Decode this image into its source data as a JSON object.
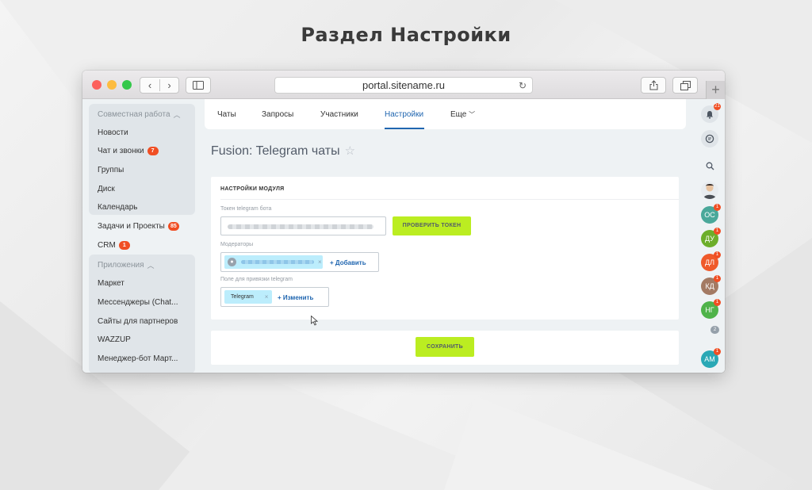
{
  "headline": "Раздел  Настройки",
  "browser": {
    "url": "portal.sitename.ru",
    "reload_icon": "reload-icon",
    "share_icon": "share-icon",
    "tabs_icon": "tabs-icon",
    "new_tab_symbol": "+"
  },
  "sidebar": {
    "group1_title": "Совместная работа",
    "items1": [
      {
        "label": "Новости"
      },
      {
        "label": "Чат и звонки",
        "badge": "7"
      },
      {
        "label": "Группы"
      },
      {
        "label": "Диск"
      },
      {
        "label": "Календарь"
      }
    ],
    "tasks": {
      "label": "Задачи и Проекты",
      "badge": "85"
    },
    "crm": {
      "label": "CRM",
      "badge": "1"
    },
    "group2_title": "Приложения",
    "items2": [
      {
        "label": "Маркет"
      },
      {
        "label": "Мессенджеры (Chat..."
      },
      {
        "label": "Сайты для партнеров"
      },
      {
        "label": "WAZZUP"
      },
      {
        "label": "Менеджер-бот Март..."
      }
    ]
  },
  "tabs": [
    "Чаты",
    "Запросы",
    "Участники",
    "Настройки",
    "Еще"
  ],
  "active_tab": "Настройки",
  "page_title": "Fusion: Telegram чаты",
  "settings": {
    "section_title": "НАСТРОЙКИ МОДУЛЯ",
    "token_label": "Токен telegram бота",
    "check_token_button": "ПРОВЕРИТЬ ТОКЕН",
    "moderators_label": "Модераторы",
    "add_label": "+ Добавить",
    "binding_field_label": "Поле для привязки telegram",
    "binding_tag": "Telegram",
    "change_label": "+ Изменить",
    "remove_symbol": "×",
    "save_button": "СОХРАНИТЬ"
  },
  "rightbar": {
    "notifications_badge": "21",
    "avatars": [
      {
        "initials": "ОС",
        "color": "#4aa89a",
        "badge": "1"
      },
      {
        "initials": "ДУ",
        "color": "#6cae2a",
        "badge": "1"
      },
      {
        "initials": "ДЛ",
        "color": "#ef5a2b",
        "badge": "1"
      },
      {
        "initials": "КД",
        "color": "#a37a63",
        "badge": "1"
      },
      {
        "initials": "НГ",
        "color": "#4fb34a",
        "badge": "1"
      },
      {
        "initials": "АМ",
        "color": "#2aa8b5",
        "badge": "1"
      }
    ],
    "more_count": "2"
  },
  "colors": {
    "accent_green": "#bbed21",
    "link_blue": "#2066b0",
    "badge_red": "#f04e23"
  }
}
